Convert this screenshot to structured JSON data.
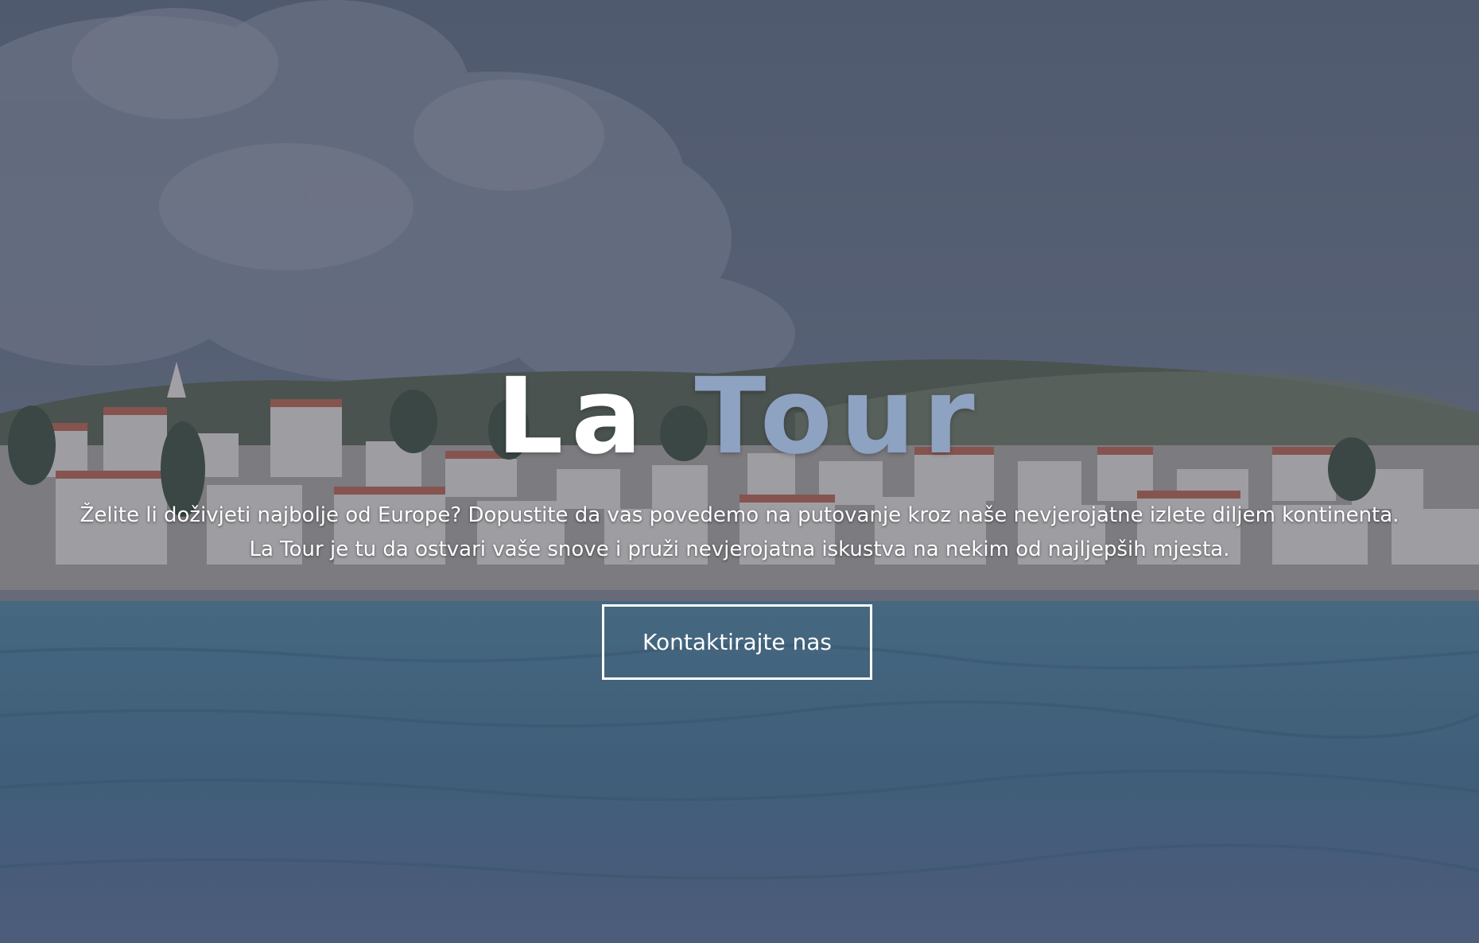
{
  "hero": {
    "title_part1": "La",
    "title_part2": "Tour",
    "tagline_line1": "Želite li doživjeti najbolje od Europe? Dopustite da vas povedemo na putovanje kroz naše nevjerojatne izlete diljem kontinenta.",
    "tagline_line2": "La Tour je tu da ostvari vaše snove i pruži nevjerojatna iskustva na nekim od najljepših mjesta.",
    "cta_label": "Kontaktirajte nas",
    "background": "coastal-town-sea-photo"
  },
  "colors": {
    "title_primary": "#ffffff",
    "title_accent": "#8ea2c1",
    "text": "#ffffff",
    "button_border": "#ffffff"
  }
}
